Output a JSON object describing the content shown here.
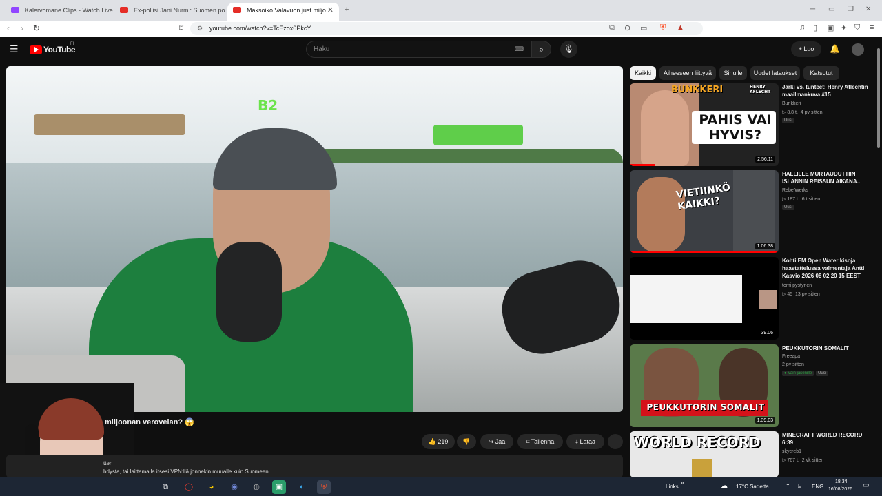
{
  "browser": {
    "tabs": [
      {
        "label": "Kalervomane Clips - Watch Live on K"
      },
      {
        "label": "Ex-poliisi Jani Nurmi: Suomen polii"
      },
      {
        "label": "Maksoiko Valavuon just miljo"
      }
    ],
    "url": "youtube.com/watch?v=TcEzox6PkcY"
  },
  "youtube": {
    "logo": "YouTube",
    "logo_sup": "FI",
    "search_placeholder": "Haku",
    "create_label": "Luo"
  },
  "video": {
    "title_partial": "miljoonan verovelan? 😱",
    "likes": "219",
    "share_label": "Jaa",
    "save_label": "Tallenna",
    "download_label": "Lataa",
    "desc_line1": "tten",
    "desc_line2": "hdysta, tai laittamalla itsesi VPN:llä jonnekin muualle kuin Suomeen."
  },
  "chips": [
    {
      "label": "Kaikki"
    },
    {
      "label": "Aiheeseen liittyvä"
    },
    {
      "label": "Sinulle"
    },
    {
      "label": "Uudet lataukset"
    },
    {
      "label": "Katsotut"
    }
  ],
  "recommendations": [
    {
      "title": "Järki vs. tunteet: Henry Aflechtin maailmankuva #15",
      "channel": "Bunkkeri",
      "views": "8,8 t.",
      "age": "4 pv sitten",
      "badge": "Uusi",
      "duration": "2.56.11",
      "thumb_title": "BUNKKERI",
      "thumb_small": "HENRY AFLECHT",
      "thumb_text": "PAHIS VAI HYVIS?"
    },
    {
      "title": "HALLILLE MURTAUDUTTIIN ISLANNIN REISSUN AIKANA..",
      "channel": "RebelWerks",
      "views": "187 t.",
      "age": "6 t sitten",
      "badge": "Uusi",
      "duration": "1.06.38",
      "thumb_text": "VIETIINKÖ KAIKKI?"
    },
    {
      "title": "Kohti EM Open Water kisoja haastattelussa valmentaja Antti Kasvio 2026 08 02 20 15 EEST",
      "channel": "tomi pystynen",
      "views": "45",
      "age": "13 pv sitten",
      "duration": "39.06"
    },
    {
      "title": "PEUKKUTORIN SOMALIT",
      "channel": "Freeapa",
      "views": "",
      "age": "2 pv sitten",
      "badge_members": "Vain jäsenille",
      "badge": "Uusi",
      "duration": "1.39.03",
      "thumb_text": "PEUKKUTORIN SOMALIT"
    },
    {
      "title": "MINECRAFT WORLD RECORD 6:39",
      "channel": "skycreb1",
      "views": "767 t.",
      "age": "2 vk sitten",
      "thumb_text": "WORLD RECORD"
    }
  ],
  "taskbar": {
    "links_label": "Links",
    "weather": "17°C  Sadetta",
    "lang": "ENG",
    "time": "18.34",
    "date": "16/08/2026"
  },
  "colors": {
    "yt_red": "#ff0000",
    "chip_selected_bg": "#f1f1f1",
    "taskbar_bg": "#1d2634"
  }
}
